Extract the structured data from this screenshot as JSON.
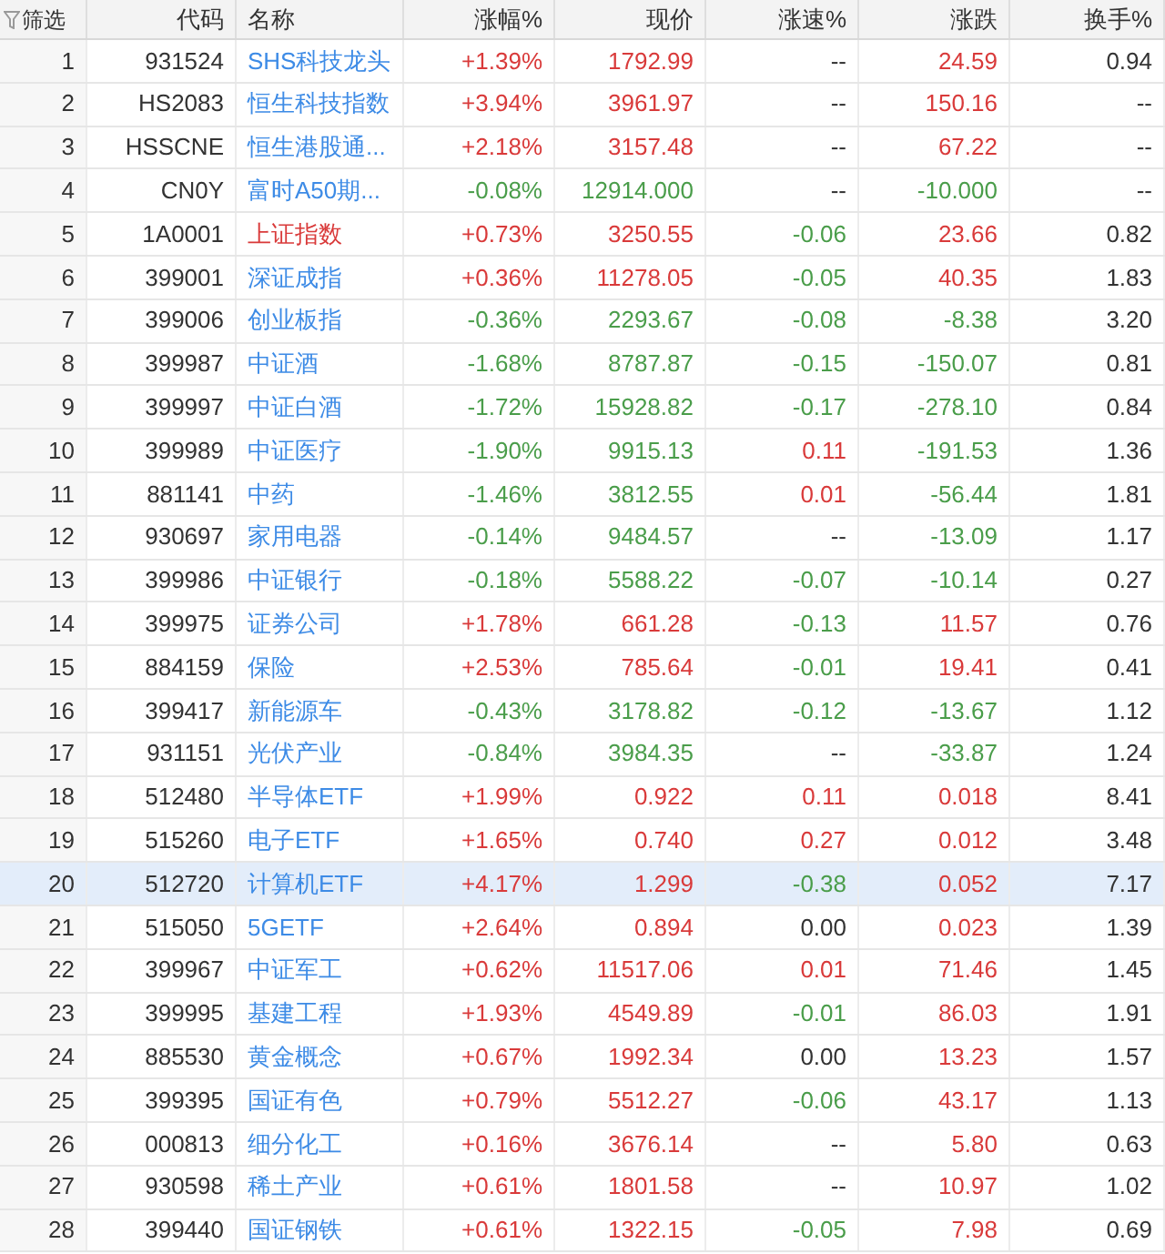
{
  "filter": {
    "label": "筛选"
  },
  "columns": [
    "代码",
    "名称",
    "涨幅%",
    "现价",
    "涨速%",
    "涨跌",
    "换手%"
  ],
  "rows": [
    {
      "index": "1",
      "code": "931524",
      "name": "SHS科技龙头",
      "color": "#3d8be6",
      "selected": false,
      "cells": [
        {
          "text": "+1.39%",
          "color": "#d93a3a"
        },
        {
          "text": "1792.99",
          "color": "#d93a3a"
        },
        {
          "text": "--",
          "color": "#333333"
        },
        {
          "text": "24.59",
          "color": "#d93a3a"
        },
        {
          "text": "0.94",
          "color": "#333333"
        }
      ]
    },
    {
      "index": "2",
      "code": "HS2083",
      "name": "恒生科技指数",
      "color": "#3d8be6",
      "selected": false,
      "cells": [
        {
          "text": "+3.94%",
          "color": "#d93a3a"
        },
        {
          "text": "3961.97",
          "color": "#d93a3a"
        },
        {
          "text": "--",
          "color": "#333333"
        },
        {
          "text": "150.16",
          "color": "#d93a3a"
        },
        {
          "text": "--",
          "color": "#333333"
        }
      ]
    },
    {
      "index": "3",
      "code": "HSSCNE",
      "name": "恒生港股通...",
      "color": "#3d8be6",
      "selected": false,
      "cells": [
        {
          "text": "+2.18%",
          "color": "#d93a3a"
        },
        {
          "text": "3157.48",
          "color": "#d93a3a"
        },
        {
          "text": "--",
          "color": "#333333"
        },
        {
          "text": "67.22",
          "color": "#d93a3a"
        },
        {
          "text": "--",
          "color": "#333333"
        }
      ]
    },
    {
      "index": "4",
      "code": "CN0Y",
      "name": "富时A50期...",
      "color": "#3d8be6",
      "selected": false,
      "cells": [
        {
          "text": "-0.08%",
          "color": "#4a9d4a"
        },
        {
          "text": "12914.000",
          "color": "#4a9d4a"
        },
        {
          "text": "--",
          "color": "#333333"
        },
        {
          "text": "-10.000",
          "color": "#4a9d4a"
        },
        {
          "text": "--",
          "color": "#333333"
        }
      ]
    },
    {
      "index": "5",
      "code": "1A0001",
      "name": "上证指数",
      "color": "#d93a3a",
      "selected": false,
      "cells": [
        {
          "text": "+0.73%",
          "color": "#d93a3a"
        },
        {
          "text": "3250.55",
          "color": "#d93a3a"
        },
        {
          "text": "-0.06",
          "color": "#4a9d4a"
        },
        {
          "text": "23.66",
          "color": "#d93a3a"
        },
        {
          "text": "0.82",
          "color": "#333333"
        }
      ]
    },
    {
      "index": "6",
      "code": "399001",
      "name": "深证成指",
      "color": "#3d8be6",
      "selected": false,
      "cells": [
        {
          "text": "+0.36%",
          "color": "#d93a3a"
        },
        {
          "text": "11278.05",
          "color": "#d93a3a"
        },
        {
          "text": "-0.05",
          "color": "#4a9d4a"
        },
        {
          "text": "40.35",
          "color": "#d93a3a"
        },
        {
          "text": "1.83",
          "color": "#333333"
        }
      ]
    },
    {
      "index": "7",
      "code": "399006",
      "name": "创业板指",
      "color": "#3d8be6",
      "selected": false,
      "cells": [
        {
          "text": "-0.36%",
          "color": "#4a9d4a"
        },
        {
          "text": "2293.67",
          "color": "#4a9d4a"
        },
        {
          "text": "-0.08",
          "color": "#4a9d4a"
        },
        {
          "text": "-8.38",
          "color": "#4a9d4a"
        },
        {
          "text": "3.20",
          "color": "#333333"
        }
      ]
    },
    {
      "index": "8",
      "code": "399987",
      "name": "中证酒",
      "color": "#3d8be6",
      "selected": false,
      "cells": [
        {
          "text": "-1.68%",
          "color": "#4a9d4a"
        },
        {
          "text": "8787.87",
          "color": "#4a9d4a"
        },
        {
          "text": "-0.15",
          "color": "#4a9d4a"
        },
        {
          "text": "-150.07",
          "color": "#4a9d4a"
        },
        {
          "text": "0.81",
          "color": "#333333"
        }
      ]
    },
    {
      "index": "9",
      "code": "399997",
      "name": "中证白酒",
      "color": "#3d8be6",
      "selected": false,
      "cells": [
        {
          "text": "-1.72%",
          "color": "#4a9d4a"
        },
        {
          "text": "15928.82",
          "color": "#4a9d4a"
        },
        {
          "text": "-0.17",
          "color": "#4a9d4a"
        },
        {
          "text": "-278.10",
          "color": "#4a9d4a"
        },
        {
          "text": "0.84",
          "color": "#333333"
        }
      ]
    },
    {
      "index": "10",
      "code": "399989",
      "name": "中证医疗",
      "color": "#3d8be6",
      "selected": false,
      "cells": [
        {
          "text": "-1.90%",
          "color": "#4a9d4a"
        },
        {
          "text": "9915.13",
          "color": "#4a9d4a"
        },
        {
          "text": "0.11",
          "color": "#d93a3a"
        },
        {
          "text": "-191.53",
          "color": "#4a9d4a"
        },
        {
          "text": "1.36",
          "color": "#333333"
        }
      ]
    },
    {
      "index": "11",
      "code": "881141",
      "name": "中药",
      "color": "#3d8be6",
      "selected": false,
      "cells": [
        {
          "text": "-1.46%",
          "color": "#4a9d4a"
        },
        {
          "text": "3812.55",
          "color": "#4a9d4a"
        },
        {
          "text": "0.01",
          "color": "#d93a3a"
        },
        {
          "text": "-56.44",
          "color": "#4a9d4a"
        },
        {
          "text": "1.81",
          "color": "#333333"
        }
      ]
    },
    {
      "index": "12",
      "code": "930697",
      "name": "家用电器",
      "color": "#3d8be6",
      "selected": false,
      "cells": [
        {
          "text": "-0.14%",
          "color": "#4a9d4a"
        },
        {
          "text": "9484.57",
          "color": "#4a9d4a"
        },
        {
          "text": "--",
          "color": "#333333"
        },
        {
          "text": "-13.09",
          "color": "#4a9d4a"
        },
        {
          "text": "1.17",
          "color": "#333333"
        }
      ]
    },
    {
      "index": "13",
      "code": "399986",
      "name": "中证银行",
      "color": "#3d8be6",
      "selected": false,
      "cells": [
        {
          "text": "-0.18%",
          "color": "#4a9d4a"
        },
        {
          "text": "5588.22",
          "color": "#4a9d4a"
        },
        {
          "text": "-0.07",
          "color": "#4a9d4a"
        },
        {
          "text": "-10.14",
          "color": "#4a9d4a"
        },
        {
          "text": "0.27",
          "color": "#333333"
        }
      ]
    },
    {
      "index": "14",
      "code": "399975",
      "name": "证券公司",
      "color": "#3d8be6",
      "selected": false,
      "cells": [
        {
          "text": "+1.78%",
          "color": "#d93a3a"
        },
        {
          "text": "661.28",
          "color": "#d93a3a"
        },
        {
          "text": "-0.13",
          "color": "#4a9d4a"
        },
        {
          "text": "11.57",
          "color": "#d93a3a"
        },
        {
          "text": "0.76",
          "color": "#333333"
        }
      ]
    },
    {
      "index": "15",
      "code": "884159",
      "name": "保险",
      "color": "#3d8be6",
      "selected": false,
      "cells": [
        {
          "text": "+2.53%",
          "color": "#d93a3a"
        },
        {
          "text": "785.64",
          "color": "#d93a3a"
        },
        {
          "text": "-0.01",
          "color": "#4a9d4a"
        },
        {
          "text": "19.41",
          "color": "#d93a3a"
        },
        {
          "text": "0.41",
          "color": "#333333"
        }
      ]
    },
    {
      "index": "16",
      "code": "399417",
      "name": "新能源车",
      "color": "#3d8be6",
      "selected": false,
      "cells": [
        {
          "text": "-0.43%",
          "color": "#4a9d4a"
        },
        {
          "text": "3178.82",
          "color": "#4a9d4a"
        },
        {
          "text": "-0.12",
          "color": "#4a9d4a"
        },
        {
          "text": "-13.67",
          "color": "#4a9d4a"
        },
        {
          "text": "1.12",
          "color": "#333333"
        }
      ]
    },
    {
      "index": "17",
      "code": "931151",
      "name": "光伏产业",
      "color": "#3d8be6",
      "selected": false,
      "cells": [
        {
          "text": "-0.84%",
          "color": "#4a9d4a"
        },
        {
          "text": "3984.35",
          "color": "#4a9d4a"
        },
        {
          "text": "--",
          "color": "#333333"
        },
        {
          "text": "-33.87",
          "color": "#4a9d4a"
        },
        {
          "text": "1.24",
          "color": "#333333"
        }
      ]
    },
    {
      "index": "18",
      "code": "512480",
      "name": "半导体ETF",
      "color": "#3d8be6",
      "selected": false,
      "cells": [
        {
          "text": "+1.99%",
          "color": "#d93a3a"
        },
        {
          "text": "0.922",
          "color": "#d93a3a"
        },
        {
          "text": "0.11",
          "color": "#d93a3a"
        },
        {
          "text": "0.018",
          "color": "#d93a3a"
        },
        {
          "text": "8.41",
          "color": "#333333"
        }
      ]
    },
    {
      "index": "19",
      "code": "515260",
      "name": "电子ETF",
      "color": "#3d8be6",
      "selected": false,
      "cells": [
        {
          "text": "+1.65%",
          "color": "#d93a3a"
        },
        {
          "text": "0.740",
          "color": "#d93a3a"
        },
        {
          "text": "0.27",
          "color": "#d93a3a"
        },
        {
          "text": "0.012",
          "color": "#d93a3a"
        },
        {
          "text": "3.48",
          "color": "#333333"
        }
      ]
    },
    {
      "index": "20",
      "code": "512720",
      "name": "计算机ETF",
      "color": "#3d8be6",
      "selected": true,
      "cells": [
        {
          "text": "+4.17%",
          "color": "#d93a3a"
        },
        {
          "text": "1.299",
          "color": "#d93a3a"
        },
        {
          "text": "-0.38",
          "color": "#4a9d4a"
        },
        {
          "text": "0.052",
          "color": "#d93a3a"
        },
        {
          "text": "7.17",
          "color": "#333333"
        }
      ]
    },
    {
      "index": "21",
      "code": "515050",
      "name": "5GETF",
      "color": "#3d8be6",
      "selected": false,
      "cells": [
        {
          "text": "+2.64%",
          "color": "#d93a3a"
        },
        {
          "text": "0.894",
          "color": "#d93a3a"
        },
        {
          "text": "0.00",
          "color": "#333333"
        },
        {
          "text": "0.023",
          "color": "#d93a3a"
        },
        {
          "text": "1.39",
          "color": "#333333"
        }
      ]
    },
    {
      "index": "22",
      "code": "399967",
      "name": "中证军工",
      "color": "#3d8be6",
      "selected": false,
      "cells": [
        {
          "text": "+0.62%",
          "color": "#d93a3a"
        },
        {
          "text": "11517.06",
          "color": "#d93a3a"
        },
        {
          "text": "0.01",
          "color": "#d93a3a"
        },
        {
          "text": "71.46",
          "color": "#d93a3a"
        },
        {
          "text": "1.45",
          "color": "#333333"
        }
      ]
    },
    {
      "index": "23",
      "code": "399995",
      "name": "基建工程",
      "color": "#3d8be6",
      "selected": false,
      "cells": [
        {
          "text": "+1.93%",
          "color": "#d93a3a"
        },
        {
          "text": "4549.89",
          "color": "#d93a3a"
        },
        {
          "text": "-0.01",
          "color": "#4a9d4a"
        },
        {
          "text": "86.03",
          "color": "#d93a3a"
        },
        {
          "text": "1.91",
          "color": "#333333"
        }
      ]
    },
    {
      "index": "24",
      "code": "885530",
      "name": "黄金概念",
      "color": "#3d8be6",
      "selected": false,
      "cells": [
        {
          "text": "+0.67%",
          "color": "#d93a3a"
        },
        {
          "text": "1992.34",
          "color": "#d93a3a"
        },
        {
          "text": "0.00",
          "color": "#333333"
        },
        {
          "text": "13.23",
          "color": "#d93a3a"
        },
        {
          "text": "1.57",
          "color": "#333333"
        }
      ]
    },
    {
      "index": "25",
      "code": "399395",
      "name": "国证有色",
      "color": "#3d8be6",
      "selected": false,
      "cells": [
        {
          "text": "+0.79%",
          "color": "#d93a3a"
        },
        {
          "text": "5512.27",
          "color": "#d93a3a"
        },
        {
          "text": "-0.06",
          "color": "#4a9d4a"
        },
        {
          "text": "43.17",
          "color": "#d93a3a"
        },
        {
          "text": "1.13",
          "color": "#333333"
        }
      ]
    },
    {
      "index": "26",
      "code": "000813",
      "name": "细分化工",
      "color": "#3d8be6",
      "selected": false,
      "cells": [
        {
          "text": "+0.16%",
          "color": "#d93a3a"
        },
        {
          "text": "3676.14",
          "color": "#d93a3a"
        },
        {
          "text": "--",
          "color": "#333333"
        },
        {
          "text": "5.80",
          "color": "#d93a3a"
        },
        {
          "text": "0.63",
          "color": "#333333"
        }
      ]
    },
    {
      "index": "27",
      "code": "930598",
      "name": "稀土产业",
      "color": "#3d8be6",
      "selected": false,
      "cells": [
        {
          "text": "+0.61%",
          "color": "#d93a3a"
        },
        {
          "text": "1801.58",
          "color": "#d93a3a"
        },
        {
          "text": "--",
          "color": "#333333"
        },
        {
          "text": "10.97",
          "color": "#d93a3a"
        },
        {
          "text": "1.02",
          "color": "#333333"
        }
      ]
    },
    {
      "index": "28",
      "code": "399440",
      "name": "国证钢铁",
      "color": "#3d8be6",
      "selected": false,
      "cells": [
        {
          "text": "+0.61%",
          "color": "#d93a3a"
        },
        {
          "text": "1322.15",
          "color": "#d93a3a"
        },
        {
          "text": "-0.05",
          "color": "#4a9d4a"
        },
        {
          "text": "7.98",
          "color": "#d93a3a"
        },
        {
          "text": "0.69",
          "color": "#333333"
        }
      ]
    }
  ]
}
